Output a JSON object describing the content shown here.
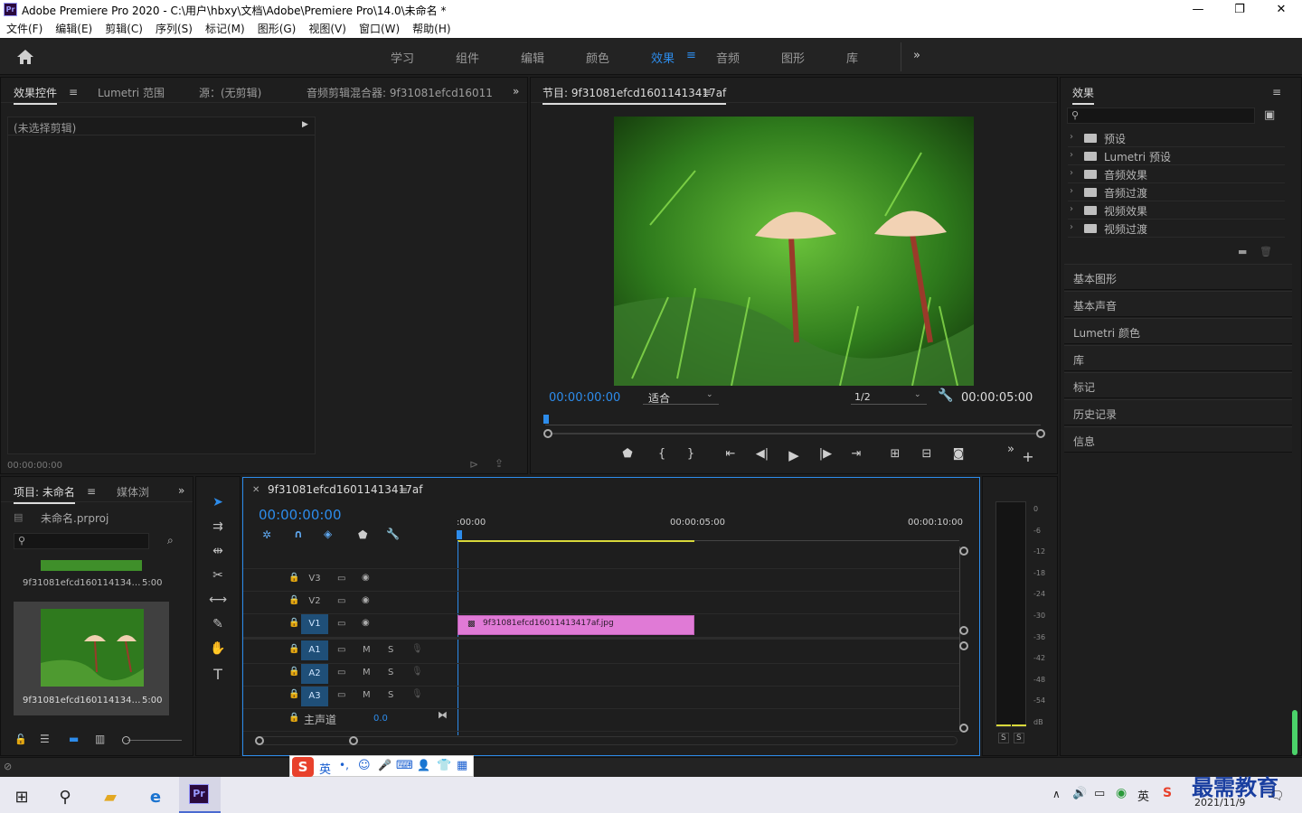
{
  "window": {
    "app_icon": "Pr",
    "title": "Adobe Premiere Pro 2020 - C:\\用户\\hbxy\\文档\\Adobe\\Premiere Pro\\14.0\\未命名 *",
    "minimize": "—",
    "maximize": "❐",
    "close": "✕"
  },
  "menu": [
    "文件(F)",
    "编辑(E)",
    "剪辑(C)",
    "序列(S)",
    "标记(M)",
    "图形(G)",
    "视图(V)",
    "窗口(W)",
    "帮助(H)"
  ],
  "workspaces": {
    "tabs": [
      "学习",
      "组件",
      "编辑",
      "颜色",
      "效果",
      "音频",
      "图形",
      "库"
    ],
    "active": "效果",
    "overflow": "»",
    "menu_icon": "≡"
  },
  "source_panel": {
    "tabs": [
      "效果控件",
      "Lumetri 范围",
      "源：(无剪辑)",
      "音频剪辑混合器: 9f31081efcd1601141:"
    ],
    "no_clip": "(未选择剪辑)",
    "timecode": "00:00:00:00"
  },
  "program_monitor": {
    "title": "节目: 9f31081efcd16011413417af",
    "current_time": "00:00:00:00",
    "fit": "适合",
    "resolution": "1/2",
    "duration": "00:00:05:00"
  },
  "effects_panel": {
    "title": "效果",
    "items": [
      "预设",
      "Lumetri 预设",
      "音频效果",
      "音频过渡",
      "视频效果",
      "视频过渡"
    ],
    "collapsed_panels": [
      "基本图形",
      "基本声音",
      "Lumetri 颜色",
      "库",
      "标记",
      "历史记录",
      "信息"
    ]
  },
  "project_panel": {
    "tabs": [
      "项目: 未命名",
      "媒体浏"
    ],
    "file": "未命名.prproj",
    "clips": [
      {
        "name": "9f31081efcd160114134…",
        "duration": "5:00"
      },
      {
        "name": "9f31081efcd160114134…",
        "duration": "5:00"
      }
    ]
  },
  "timeline": {
    "sequence_name": "9f31081efcd16011413417af",
    "timecode": "00:00:00:00",
    "ruler": [
      ":00:00",
      "00:00:05:00",
      "00:00:10:00"
    ],
    "video_tracks": [
      "V3",
      "V2",
      "V1"
    ],
    "audio_tracks": [
      "A1",
      "A2",
      "A3"
    ],
    "master_label": "主声道",
    "master_value": "0.0",
    "clip_name": "9f31081efcd16011413417af.jpg",
    "clip_color": "#e07ad6",
    "mute": "M",
    "solo": "S"
  },
  "audio_meter": {
    "scale": [
      "0",
      "-6",
      "-12",
      "-18",
      "-24",
      "-30",
      "-36",
      "-42",
      "-48",
      "-54",
      "dB"
    ],
    "solo_left": "S",
    "solo_right": "S"
  },
  "ime_bar": {
    "mode": "英"
  },
  "taskbar": {
    "tray_lang": "英",
    "date": "2021/11/9",
    "watermark": "最需教育"
  },
  "colors": {
    "accent": "#2d8ceb",
    "panel": "#1e1e1e",
    "timeline_blue": "#1f4f78"
  }
}
